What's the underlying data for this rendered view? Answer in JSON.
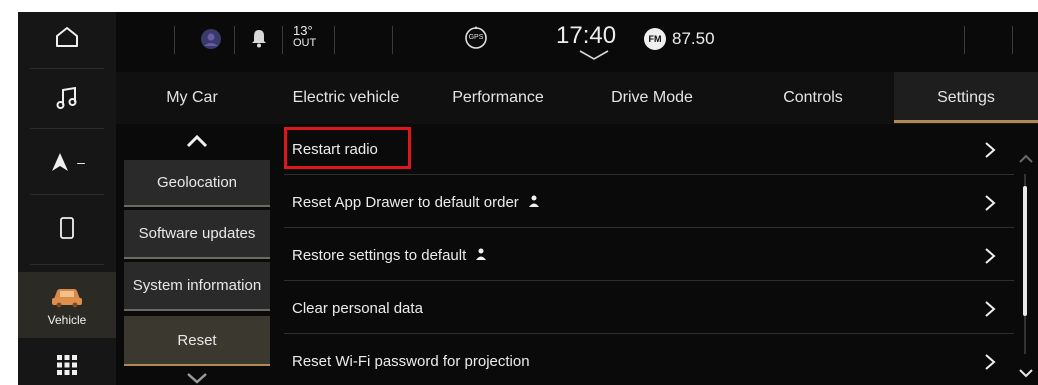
{
  "rail": {
    "vehicle_label": "Vehicle",
    "nav_dash": "–"
  },
  "status": {
    "temperature": "13°",
    "temperature_unit": "OUT",
    "gps_label": "GPS",
    "time": "17:40",
    "radio_band": "FM",
    "radio_freq": "87.50"
  },
  "tabs": [
    {
      "label": "My Car"
    },
    {
      "label": "Electric vehicle"
    },
    {
      "label": "Performance"
    },
    {
      "label": "Drive Mode"
    },
    {
      "label": "Controls"
    },
    {
      "label": "Settings",
      "active": true
    }
  ],
  "submenu": [
    {
      "label": "Geolocation"
    },
    {
      "label": "Software updates"
    },
    {
      "label": "System information"
    },
    {
      "label": "Reset",
      "active": true
    }
  ],
  "list": [
    {
      "label": "Restart radio",
      "user_icon": false,
      "highlighted": true
    },
    {
      "label": "Reset App Drawer to default order",
      "user_icon": true
    },
    {
      "label": "Restore settings to default",
      "user_icon": true
    },
    {
      "label": "Clear personal data",
      "user_icon": false
    },
    {
      "label": "Reset Wi-Fi password for projection",
      "user_icon": false
    }
  ],
  "colors": {
    "accent": "#b08a55",
    "highlight_box": "#e0161d",
    "background": "#0a0a0a"
  }
}
